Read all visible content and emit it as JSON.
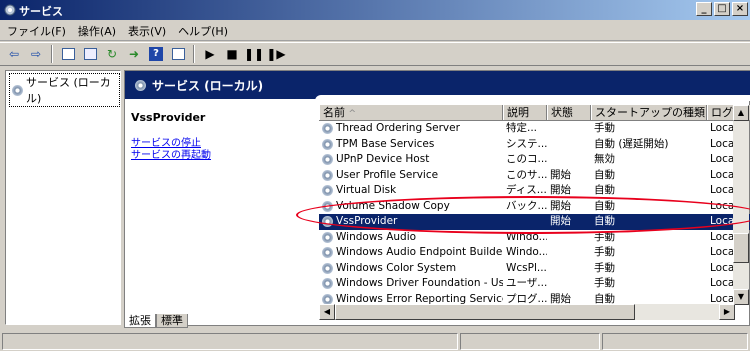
{
  "window": {
    "title": "サービス",
    "buttons": [
      "_",
      "□",
      "×"
    ]
  },
  "menu": {
    "items": [
      "ファイル(F)",
      "操作(A)",
      "表示(V)",
      "ヘルプ(H)"
    ]
  },
  "toolbar": {
    "icons": [
      "back-icon",
      "forward-icon",
      "console-tree-icon",
      "properties-icon",
      "refresh-icon",
      "export-icon",
      "help-icon",
      "show-hide-icon",
      "play-icon",
      "stop-icon",
      "pause-icon",
      "restart-icon"
    ]
  },
  "tree": {
    "item": "サービス (ローカル)"
  },
  "main": {
    "header": "サービス (ローカル)",
    "selected_service": "VssProvider",
    "links": [
      "サービスの停止",
      "サービスの再起動"
    ]
  },
  "list": {
    "columns": [
      "名前",
      "説明",
      "状態",
      "スタートアップの種類",
      "ログオ"
    ],
    "rows": [
      {
        "name": "Thread Ordering Server",
        "desc": "特定...",
        "status": "",
        "startup": "手動",
        "logon": "Loca"
      },
      {
        "name": "TPM Base Services",
        "desc": "システ...",
        "status": "",
        "startup": "自動 (遅延開始)",
        "logon": "Loca"
      },
      {
        "name": "UPnP Device Host",
        "desc": "このコ...",
        "status": "",
        "startup": "無効",
        "logon": "Loca"
      },
      {
        "name": "User Profile Service",
        "desc": "このサ...",
        "status": "開始",
        "startup": "自動",
        "logon": "Loca"
      },
      {
        "name": "Virtual Disk",
        "desc": "ディス...",
        "status": "開始",
        "startup": "自動",
        "logon": "Loca"
      },
      {
        "name": "Volume Shadow Copy",
        "desc": "バック...",
        "status": "開始",
        "startup": "自動",
        "logon": "Loca"
      },
      {
        "name": "VssProvider",
        "desc": "",
        "status": "開始",
        "startup": "自動",
        "logon": "Loca",
        "selected": true
      },
      {
        "name": "Windows Audio",
        "desc": "Windo...",
        "status": "",
        "startup": "手動",
        "logon": "Loca"
      },
      {
        "name": "Windows Audio Endpoint Builder",
        "desc": "Windo...",
        "status": "",
        "startup": "手動",
        "logon": "Loca"
      },
      {
        "name": "Windows Color System",
        "desc": "WcsPl...",
        "status": "",
        "startup": "手動",
        "logon": "Loca"
      },
      {
        "name": "Windows Driver Foundation - Us...",
        "desc": "ユーザ...",
        "status": "",
        "startup": "手動",
        "logon": "Loca"
      },
      {
        "name": "Windows Error Reporting Service",
        "desc": "プログ...",
        "status": "開始",
        "startup": "自動",
        "logon": "Loca"
      }
    ]
  },
  "tabs": [
    "拡張",
    "標準"
  ],
  "colors": {
    "title_bar": "#0a246a",
    "selection": "#0a246a",
    "annotation": "#e8001c",
    "link": "#0000ee"
  }
}
